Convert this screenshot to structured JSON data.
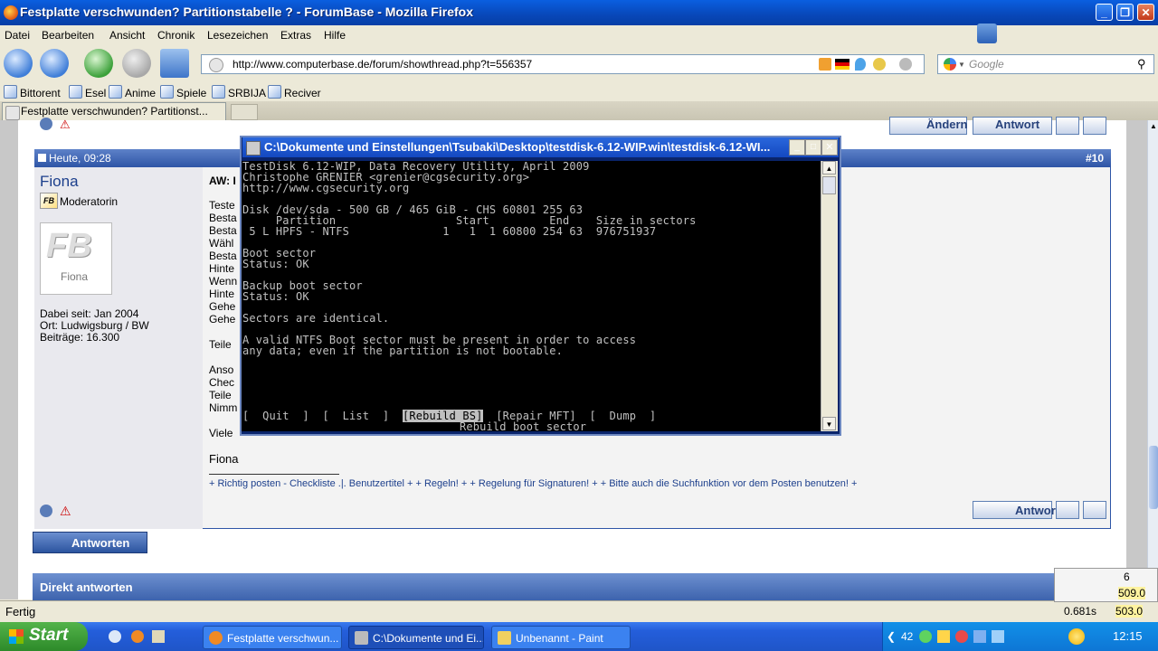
{
  "window": {
    "title": "Festplatte verschwunden? Partitionstabelle ? - ForumBase - Mozilla Firefox"
  },
  "menu": [
    "Datei",
    "Bearbeiten",
    "Ansicht",
    "Chronik",
    "Lesezeichen",
    "Extras",
    "Hilfe"
  ],
  "nav": {
    "url": "http://www.computerbase.de/forum/showthread.php?t=556357",
    "search_placeholder": "Google"
  },
  "bookmarks": [
    "Bittorent",
    "Esel",
    "Anime",
    "Spiele",
    "SRBIJA",
    "Reciver"
  ],
  "tabs": [
    {
      "label": "Festplatte verschwunden? Partitionst..."
    }
  ],
  "post": {
    "date": "Heute, 09:28",
    "number": "#10",
    "author": "Fiona",
    "role": "Moderatorin",
    "avatar_text": "Fiona",
    "joined": "Dabei seit: Jan 2004",
    "location": "Ort: Ludwigsburg / BW",
    "posts": "Beiträge: 16.300",
    "subject": "AW: I",
    "body_fragments": [
      "Teste",
      "Besta",
      "Besta",
      "Wähl",
      "Besta",
      "Hinte",
      "Wenn",
      "Hinte",
      "Gehe",
      "Gehe",
      "Teile",
      "Anso",
      "Chec",
      "Teile",
      "Nimm",
      "Viele"
    ],
    "signature_name": "Fiona",
    "signature_links": "+ Richtig posten - Checkliste .|. Benutzertitel + + Regeln! + + Regelung für Signaturen! + + Bitte auch die Suchfunktion vor dem Posten benutzen! +",
    "edit_label": "Ändern",
    "reply_label": "Antwort"
  },
  "reply_button": "Antworten",
  "direct_reply": "Direkt antworten",
  "console": {
    "title": "C:\\Dokumente und Einstellungen\\Tsubaki\\Desktop\\testdisk-6.12-WIP.win\\testdisk-6.12-WI...",
    "lines": [
      "TestDisk 6.12-WIP, Data Recovery Utility, April 2009",
      "Christophe GRENIER <grenier@cgsecurity.org>",
      "http://www.cgsecurity.org",
      "",
      "Disk /dev/sda - 500 GB / 465 GiB - CHS 60801 255 63",
      "     Partition                  Start         End    Size in sectors",
      " 5 L HPFS - NTFS              1   1  1 60800 254 63  976751937",
      "",
      "Boot sector",
      "Status: OK",
      "",
      "Backup boot sector",
      "Status: OK",
      "",
      "Sectors are identical.",
      "",
      "A valid NTFS Boot sector must be present in order to access",
      "any data; even if the partition is not bootable."
    ],
    "menu_before": "[  Quit  ]  [  List  ]  ",
    "menu_selected": "[Rebuild BS]",
    "menu_after": "  [Repair MFT]  [  Dump  ]",
    "hint": "Rebuild boot sector"
  },
  "status": {
    "text": "Fertig",
    "timing": "0.681s",
    "tray_value1": "509.0",
    "tray_value2": "503.0",
    "tray_count": "6"
  },
  "taskbar": {
    "start": "Start",
    "tasks": [
      "Festplatte verschwun...",
      "C:\\Dokumente und Ei...",
      "Unbenannt - Paint"
    ],
    "clock": "12:15",
    "temp": "42"
  },
  "colors": {
    "xp_blue": "#245edb",
    "console_bg": "#000000",
    "console_fg": "#c0c0c0",
    "post_header": "#2e55a6",
    "sig_plus": "#cc0000"
  }
}
